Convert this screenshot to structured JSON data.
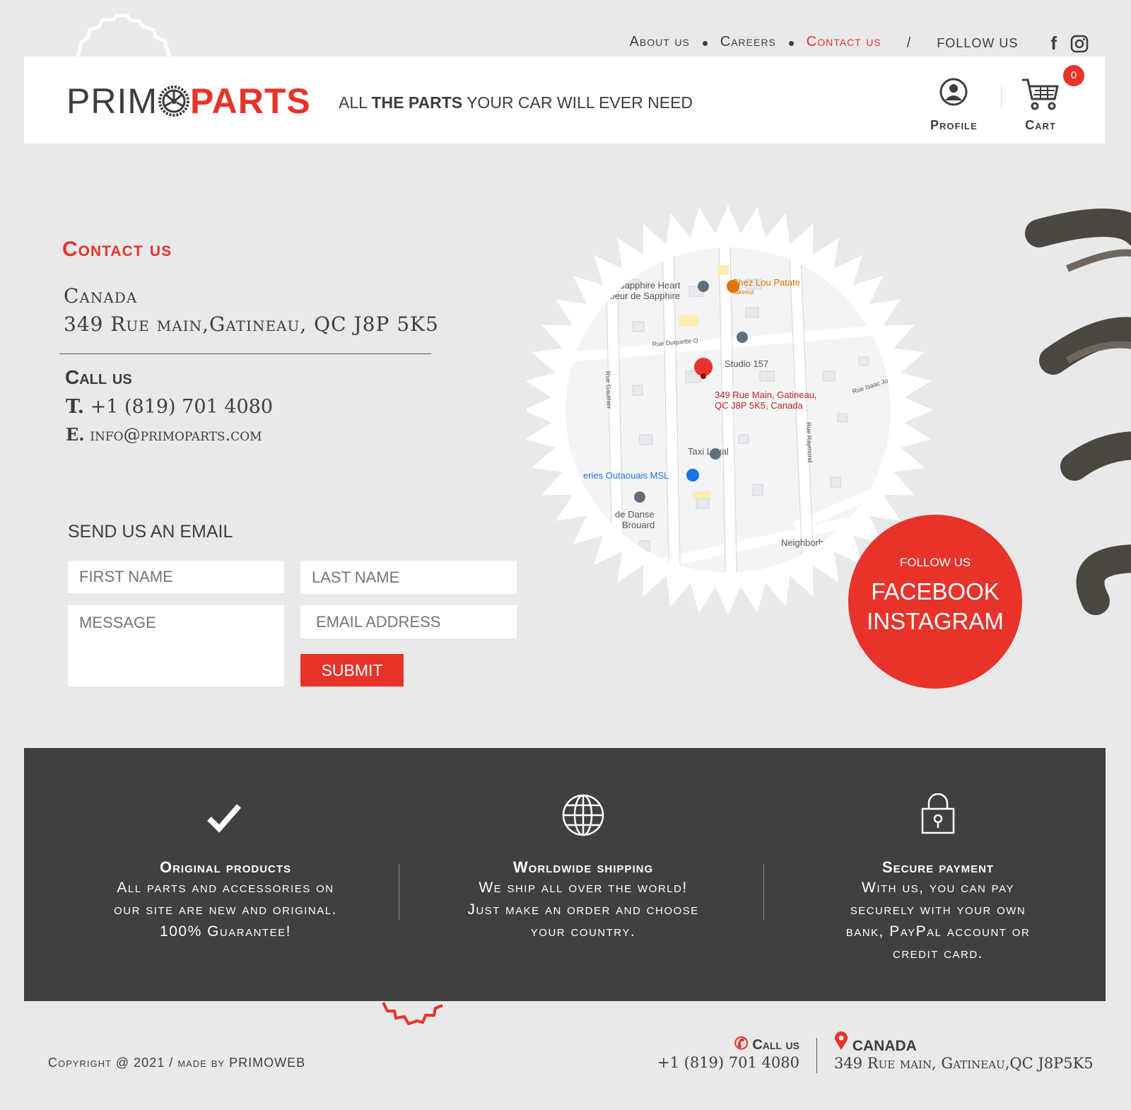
{
  "topnav": {
    "items": [
      "About us",
      "Careers",
      "Contact us"
    ],
    "active": "Contact us",
    "sep": "/",
    "follow": "FOLLOW US"
  },
  "header": {
    "logo_a": "PRIM",
    "logo_b": "PARTS",
    "tagline_1": "ALL ",
    "tagline_2": "THE PARTS",
    "tagline_3": " YOUR CAR  WILL EVER NEED",
    "profile": "Profile",
    "cart": "Cart",
    "cart_count": "0"
  },
  "contact": {
    "title": "Contact us",
    "country": "Canada",
    "address": "349 Rue main,Gatineau, QC J8P 5K5",
    "call_title": "Call us",
    "t_label": "T.",
    "phone": "+1 (819) 701 4080",
    "e_label": "E.",
    "email": "info@primoparts.com"
  },
  "form": {
    "title": "SEND US AN EMAIL",
    "first": "FIRST NAME",
    "last": "LAST NAME",
    "message": "MESSAGE",
    "email": "EMAIL ADDRESS",
    "submit": "SUBMIT"
  },
  "map": {
    "labels": [
      "Sapphire Heart",
      "Coeur de Sapphire",
      "Chez Lou Patate",
      "Takeout",
      "Rue Duquette O",
      "Studio 157",
      "349 Rue Main, Gatineau,",
      "QC J8P 5K5, Canada",
      "Rue Gauthier",
      "Rue Isaac Jog",
      "Rue Raymond",
      "Taxi Loyal",
      "eries Outaouais MSL",
      "de Danse",
      "Brouard",
      "Neighborho"
    ]
  },
  "follow": {
    "small": "FOLLOW US",
    "facebook": "FACEBOOK",
    "instagram": "INSTAGRAM"
  },
  "features": [
    {
      "title": "Original products",
      "lines": [
        "All parts and accessories on",
        "our site are new and original.",
        "100% Guarantee!"
      ]
    },
    {
      "title": "Worldwide shipping",
      "lines": [
        "We ship all over the world!",
        "Just make an order and choose",
        "your country."
      ]
    },
    {
      "title": "Secure payment",
      "lines": [
        "With us, you can pay",
        "securely with your own",
        "bank, PayPal account or",
        "credit card."
      ]
    }
  ],
  "footer": {
    "copyright": "Copyright @ 2021 /  made by PRIMOWEB",
    "call_title": "Call us",
    "phone": "+1 (819) 701 4080",
    "country": "CANADA",
    "address": "349 Rue main, Gatineau,QC J8P5K5"
  },
  "colors": {
    "accent": "#e8332b",
    "dark": "#404040",
    "bg": "#e9e9e9"
  }
}
